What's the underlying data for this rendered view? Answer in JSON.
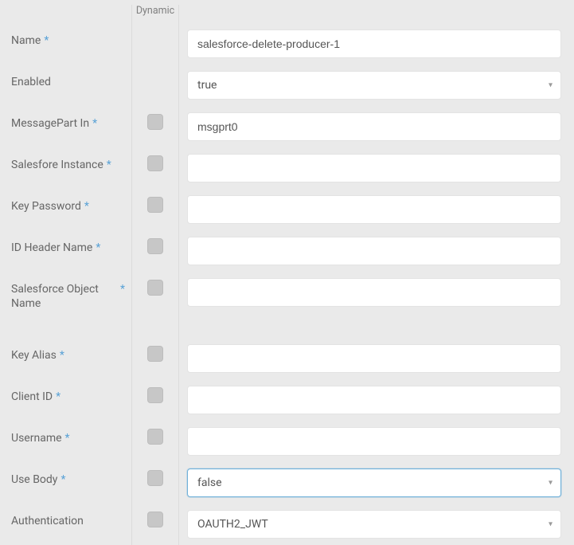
{
  "header": {
    "dynamic": "Dynamic"
  },
  "fields": {
    "name": {
      "label": "Name",
      "required": true,
      "dynamic": false,
      "type": "text",
      "value": "salesforce-delete-producer-1"
    },
    "enabled": {
      "label": "Enabled",
      "required": false,
      "dynamic": false,
      "type": "select",
      "value": "true"
    },
    "msgin": {
      "label": "MessagePart In",
      "required": true,
      "dynamic": true,
      "type": "text",
      "value": "msgprt0"
    },
    "instance": {
      "label": "Salesfore Instance",
      "required": true,
      "dynamic": true,
      "type": "text",
      "value": ""
    },
    "keypass": {
      "label": "Key Password",
      "required": true,
      "dynamic": true,
      "type": "text",
      "value": ""
    },
    "idheader": {
      "label": "ID Header Name",
      "required": true,
      "dynamic": true,
      "type": "text",
      "value": ""
    },
    "objname": {
      "label": "Salesforce Object Name",
      "required": true,
      "dynamic": true,
      "type": "text",
      "value": ""
    },
    "keyalias": {
      "label": "Key Alias",
      "required": true,
      "dynamic": true,
      "type": "text",
      "value": ""
    },
    "clientid": {
      "label": "Client ID",
      "required": true,
      "dynamic": true,
      "type": "text",
      "value": ""
    },
    "username": {
      "label": "Username",
      "required": true,
      "dynamic": true,
      "type": "text",
      "value": ""
    },
    "usebody": {
      "label": "Use Body",
      "required": true,
      "dynamic": true,
      "type": "select",
      "value": "false",
      "active": true
    },
    "auth": {
      "label": "Authentication",
      "required": false,
      "dynamic": true,
      "type": "select",
      "value": "OAUTH2_JWT"
    }
  },
  "order": [
    "name",
    "enabled",
    "msgin",
    "instance",
    "keypass",
    "idheader",
    "objname",
    "_gap_",
    "keyalias",
    "clientid",
    "username",
    "usebody",
    "auth"
  ],
  "asterisk": "*"
}
